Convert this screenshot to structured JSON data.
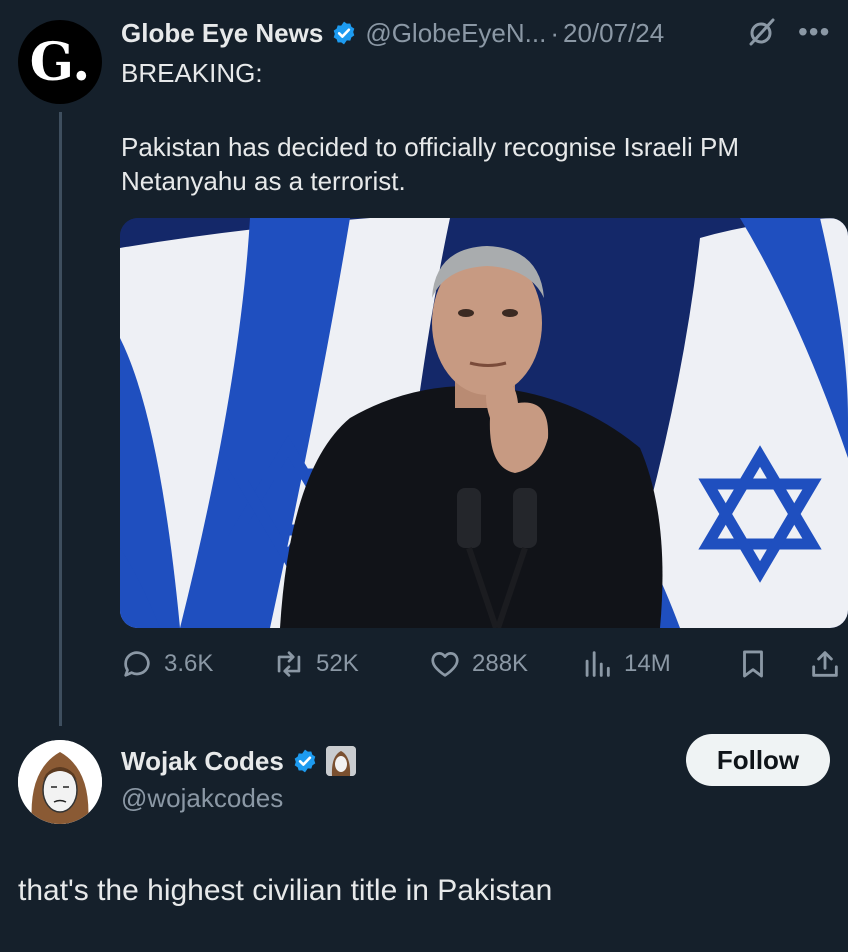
{
  "tweet": {
    "avatar_letter": "G.",
    "author_name": "Globe Eye News",
    "handle": "@GlobeEyeN...",
    "separator": "·",
    "date": "20/07/24",
    "breaking": "BREAKING:",
    "body": "Pakistan has decided to officially recognise Israeli PM Netanyahu as a terrorist.",
    "stats": {
      "replies": "3.6K",
      "reposts": "52K",
      "likes": "288K",
      "views": "14M"
    }
  },
  "reply": {
    "author_name": "Wojak Codes",
    "handle": "@wojakcodes",
    "follow_label": "Follow",
    "text": "that's the highest civilian title in Pakistan"
  },
  "colors": {
    "background": "#15202b",
    "verified": "#1d9bf0",
    "muted": "#8b98a5",
    "flag_blue": "#1f4fbf"
  },
  "icons": [
    "verified-badge-icon",
    "grok-icon",
    "more-icon",
    "reply-icon",
    "repost-icon",
    "like-icon",
    "views-icon",
    "bookmark-icon",
    "share-icon"
  ]
}
